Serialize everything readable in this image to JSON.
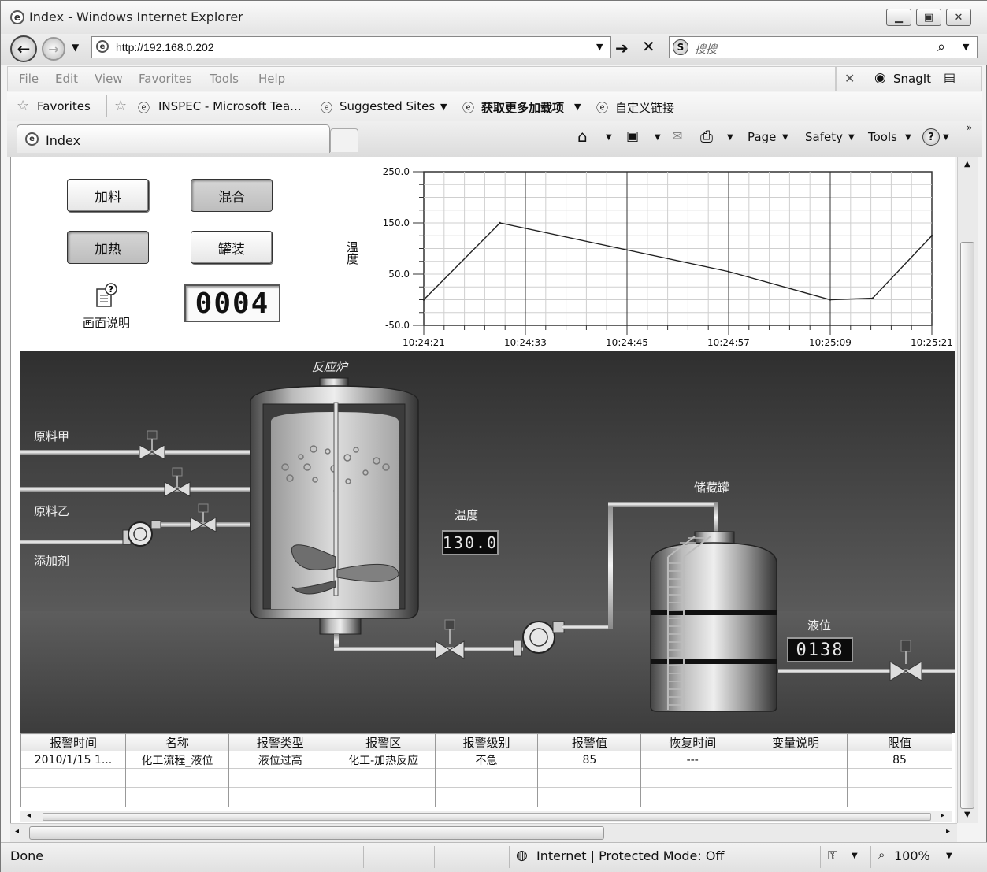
{
  "window": {
    "title": "Index - Windows Internet Explorer",
    "url": "http://192.168.0.202",
    "search_placeholder": "搜搜"
  },
  "menu": [
    "File",
    "Edit",
    "View",
    "Favorites",
    "Tools",
    "Help"
  ],
  "snagit": {
    "label": "SnagIt"
  },
  "favorites": {
    "label": "Favorites",
    "items": [
      "INSPEC - Microsoft Tea...",
      "Suggested Sites",
      "获取更多加载项",
      "自定义链接"
    ]
  },
  "tab": {
    "title": "Index"
  },
  "commands": {
    "page": "Page",
    "safety": "Safety",
    "tools": "Tools"
  },
  "controls": {
    "buttons": [
      "加料",
      "混合",
      "加热",
      "罐装"
    ],
    "help_label": "画面说明",
    "counter": "0004"
  },
  "chart_data": {
    "type": "line",
    "ylabel": "温度",
    "ylim": [
      -50,
      250
    ],
    "y_ticks": [
      "250.0",
      "150.0",
      "50.0",
      "-50.0"
    ],
    "x_ticks": [
      "10:24:21",
      "10:24:33",
      "10:24:45",
      "10:24:57",
      "10:25:09",
      "10:25:21"
    ],
    "xlim": [
      0,
      60
    ],
    "grid": true,
    "series": [
      {
        "x": [
          0,
          9,
          36,
          48,
          53,
          60
        ],
        "y": [
          0,
          150,
          55,
          0,
          3,
          125
        ]
      }
    ]
  },
  "process": {
    "reactor_label": "反应炉",
    "feed_a": "原料甲",
    "feed_b": "原料乙",
    "additive": "添加剂",
    "temperature_label": "温度",
    "temperature_value": "130.0",
    "storage_label": "储藏罐",
    "level_label": "液位",
    "level_value": "0138"
  },
  "alarms": {
    "columns": [
      "报警时间",
      "名称",
      "报警类型",
      "报警区",
      "报警级别",
      "报警值",
      "恢复时间",
      "变量说明",
      "限值"
    ],
    "rows": [
      [
        "2010/1/15 1...",
        "化工流程_液位",
        "液位过高",
        "化工-加热反应",
        "不急",
        "85",
        "---",
        "",
        "85"
      ]
    ]
  },
  "status": {
    "left": "Done",
    "zone": "Internet | Protected Mode: Off",
    "zoom": "100%"
  }
}
